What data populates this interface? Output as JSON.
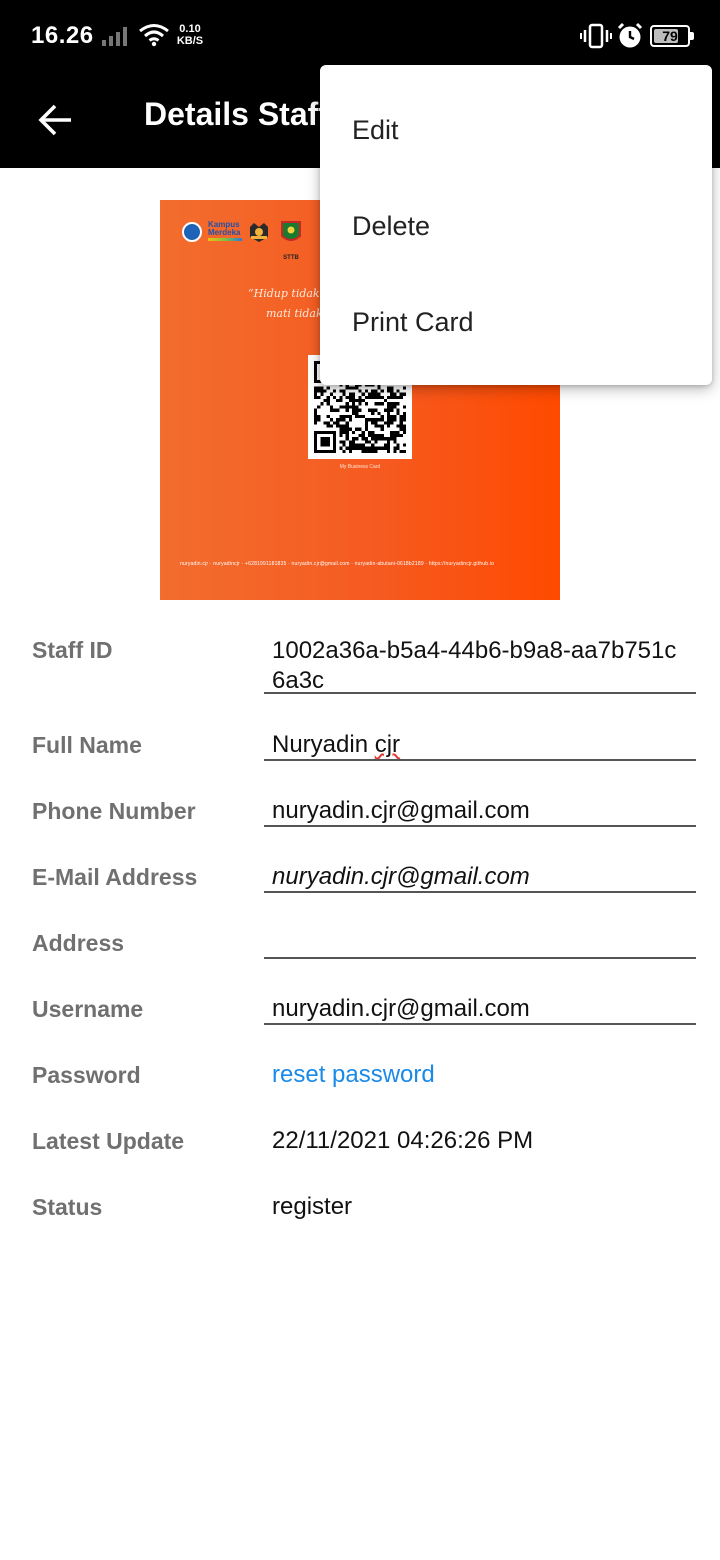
{
  "status_bar": {
    "time": "16.26",
    "net_speed_value": "0.10",
    "net_speed_unit": "KB/S",
    "battery_level": 79,
    "battery_text": "79",
    "icons": [
      "signal-icon",
      "wifi-icon",
      "vibrate-icon",
      "alarm-icon",
      "battery-icon"
    ]
  },
  "app_bar": {
    "back_icon": "arrow-left-icon",
    "title": "Details Staff"
  },
  "card": {
    "brand_color": "#f65a20",
    "logo_text": "Kampus Merdeka",
    "sttb_label": "STTB",
    "quote_line_1": "“Hidup tidak",
    "quote_line_2": "mati tidak",
    "caption": "My Business Card",
    "footer": "nuryadin.cjr  ·  nuryadincjr  ·  +6281991181835  ·  nuryadin.cjr@gmail.com  ·  nuryadin-abutani-0618b2189  ·  https://nuryadincjr.github.io"
  },
  "fields": {
    "staff_id": {
      "label": "Staff ID",
      "value": "1002a36a-b5a4-44b6-b9a8-aa7b751c6a3c"
    },
    "full_name": {
      "label": "Full Name",
      "value_part1": "Nuryadin ",
      "value_part2": "cjr"
    },
    "phone": {
      "label": "Phone Number",
      "value": "nuryadin.cjr@gmail.com"
    },
    "email": {
      "label": "E-Mail Address",
      "value": "nuryadin.cjr@gmail.com"
    },
    "address": {
      "label": "Address",
      "value": ""
    },
    "username": {
      "label": "Username",
      "value": "nuryadin.cjr@gmail.com"
    },
    "password": {
      "label": "Password",
      "link_text": "reset password",
      "link_color": "#1a8ae8"
    },
    "latest_update": {
      "label": "Latest Update",
      "value": "22/11/2021 04:26:26 PM"
    },
    "status": {
      "label": "Status",
      "value": "register"
    }
  },
  "menu": {
    "items": [
      {
        "label": "Edit"
      },
      {
        "label": "Delete"
      },
      {
        "label": "Print Card"
      }
    ]
  }
}
